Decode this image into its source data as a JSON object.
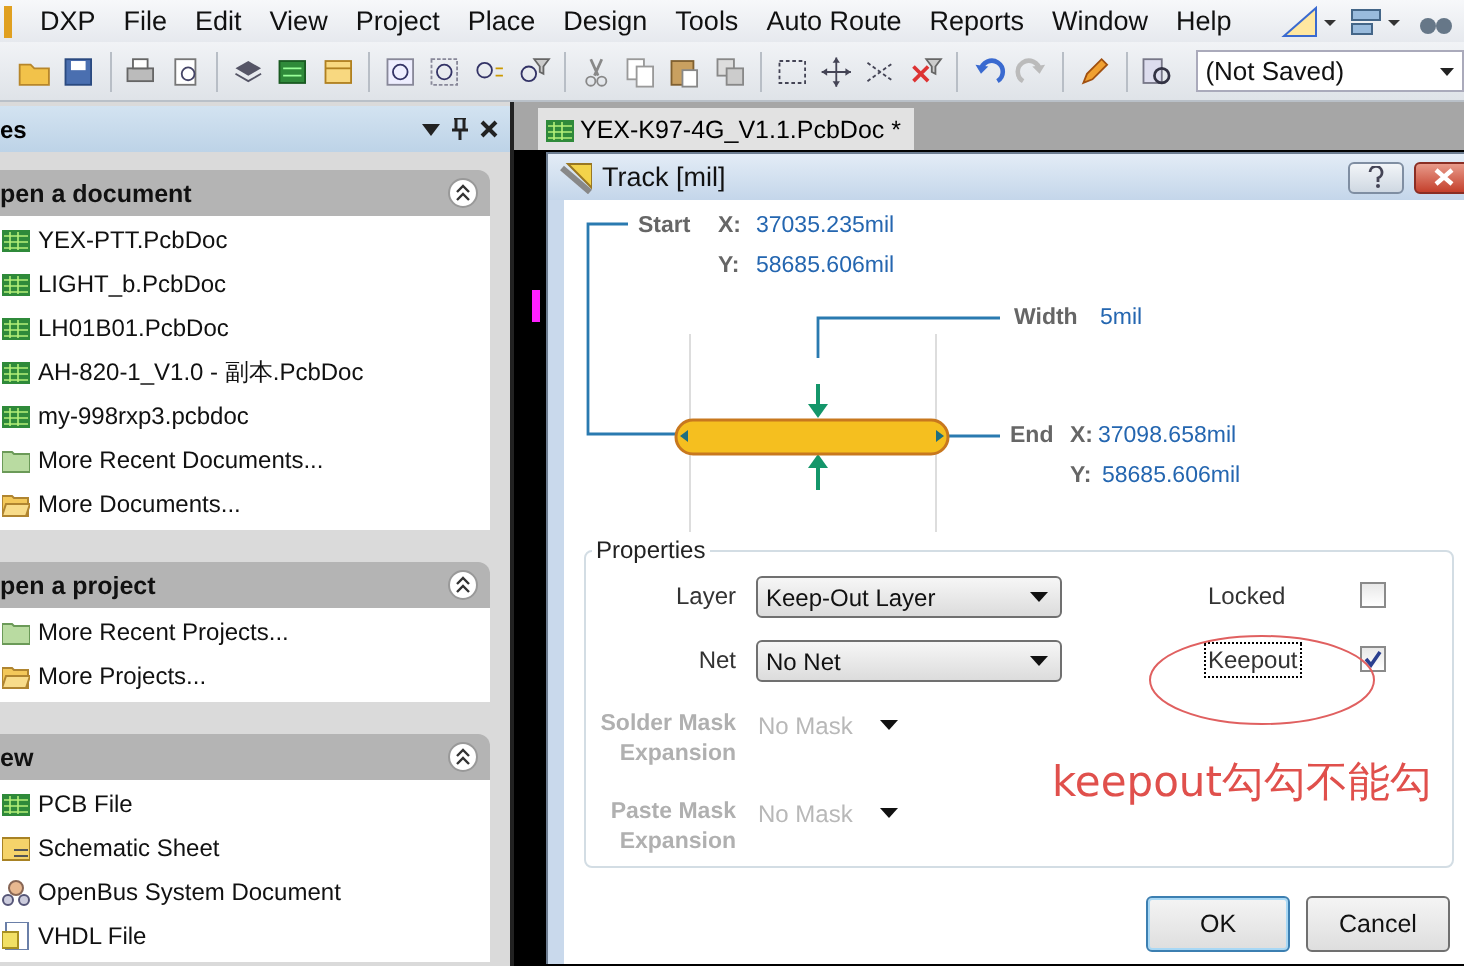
{
  "menu": {
    "items": [
      "DXP",
      "File",
      "Edit",
      "View",
      "Project",
      "Place",
      "Design",
      "Tools",
      "Auto Route",
      "Reports",
      "Window",
      "Help"
    ]
  },
  "toolbar": {
    "config_value": "(Not Saved)"
  },
  "panel": {
    "title": "es",
    "sections": [
      {
        "title": "pen a document",
        "items": [
          {
            "label": "YEX-PTT.PcbDoc",
            "kind": "pcb"
          },
          {
            "label": "LIGHT_b.PcbDoc",
            "kind": "pcb"
          },
          {
            "label": "LH01B01.PcbDoc",
            "kind": "pcb"
          },
          {
            "label": "AH-820-1_V1.0 - 副本.PcbDoc",
            "kind": "pcb"
          },
          {
            "label": "my-998rxp3.pcbdoc",
            "kind": "pcb"
          },
          {
            "label": "More Recent Documents...",
            "kind": "folder"
          },
          {
            "label": "More Documents...",
            "kind": "open"
          }
        ]
      },
      {
        "title": "pen a project",
        "items": [
          {
            "label": "More Recent Projects...",
            "kind": "folder"
          },
          {
            "label": "More Projects...",
            "kind": "open"
          }
        ]
      },
      {
        "title": "ew",
        "items": [
          {
            "label": "PCB File",
            "kind": "pcb"
          },
          {
            "label": "Schematic Sheet",
            "kind": "schematic"
          },
          {
            "label": "OpenBus System Document",
            "kind": "openbus"
          },
          {
            "label": "VHDL File",
            "kind": "vhdl"
          }
        ]
      }
    ]
  },
  "document_tab": {
    "label": "YEX-K97-4G_V1.1.PcbDoc *"
  },
  "dialog": {
    "title": "Track [mil]",
    "start": {
      "label": "Start",
      "x_label": "X:",
      "x": "37035.235mil",
      "y_label": "Y:",
      "y": "58685.606mil"
    },
    "width": {
      "label": "Width",
      "value": "5mil"
    },
    "end": {
      "label": "End",
      "x_label": "X:",
      "x": "37098.658mil",
      "y_label": "Y:",
      "y": "58685.606mil"
    },
    "properties": {
      "title": "Properties",
      "fields": [
        {
          "label": "Layer",
          "value": "Keep-Out Layer",
          "disabled": false
        },
        {
          "label": "Net",
          "value": "No Net",
          "disabled": false
        },
        {
          "label": "Solder Mask Expansion",
          "value": "No Mask",
          "disabled": true
        },
        {
          "label": "Paste Mask Expansion",
          "value": "No Mask",
          "disabled": true
        }
      ],
      "checks": [
        {
          "label": "Locked",
          "checked": false,
          "focused": false
        },
        {
          "label": "Keepout",
          "checked": true,
          "focused": true
        }
      ]
    },
    "annotation": "keepout勾勾不能勾",
    "buttons": [
      {
        "label": "OK",
        "default": true
      },
      {
        "label": "Cancel",
        "default": false
      }
    ]
  }
}
